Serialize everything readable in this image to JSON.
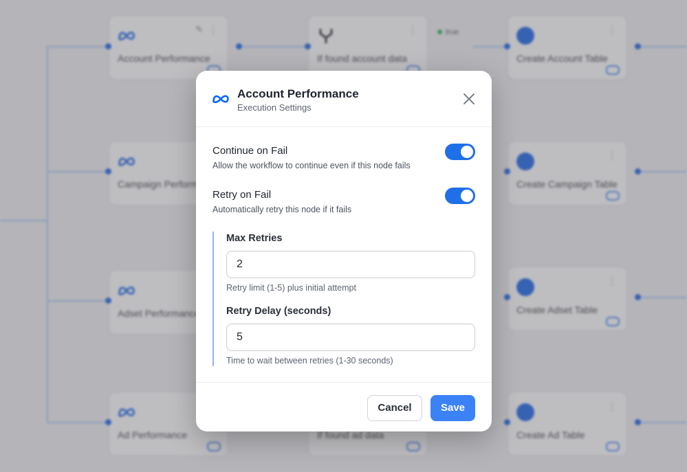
{
  "canvas": {
    "nodes": [
      {
        "label": "Account Performance",
        "icon": "meta-icon"
      },
      {
        "label": "If found account data",
        "icon": "branch-icon"
      },
      {
        "label": "Create Account Table",
        "icon": "circle-icon"
      },
      {
        "label": "Campaign Performance",
        "icon": "meta-icon"
      },
      {
        "label": "Create Campaign Table",
        "icon": "circle-icon"
      },
      {
        "label": "Adset Performance",
        "icon": "meta-icon"
      },
      {
        "label": "Create Adset Table",
        "icon": "circle-icon"
      },
      {
        "label": "Ad Performance",
        "icon": "meta-icon"
      },
      {
        "label": "If found ad data",
        "icon": "branch-icon"
      },
      {
        "label": "Create Ad Table",
        "icon": "circle-icon"
      }
    ],
    "badge": "true"
  },
  "modal": {
    "title": "Account Performance",
    "subtitle": "Execution Settings",
    "continue_on_fail": {
      "title": "Continue on Fail",
      "description": "Allow the workflow to continue even if this node fails",
      "enabled": true
    },
    "retry_on_fail": {
      "title": "Retry on Fail",
      "description": "Automatically retry this node if it fails",
      "enabled": true
    },
    "max_retries": {
      "label": "Max Retries",
      "value": "2",
      "help": "Retry limit (1-5) plus initial attempt"
    },
    "retry_delay": {
      "label": "Retry Delay (seconds)",
      "value": "5",
      "help": "Time to wait between retries (1-30 seconds)"
    },
    "cancel_label": "Cancel",
    "save_label": "Save"
  },
  "colors": {
    "accent": "#1f6fe8",
    "save_button": "#3b82f6",
    "meta_blue": "#0866ff"
  }
}
